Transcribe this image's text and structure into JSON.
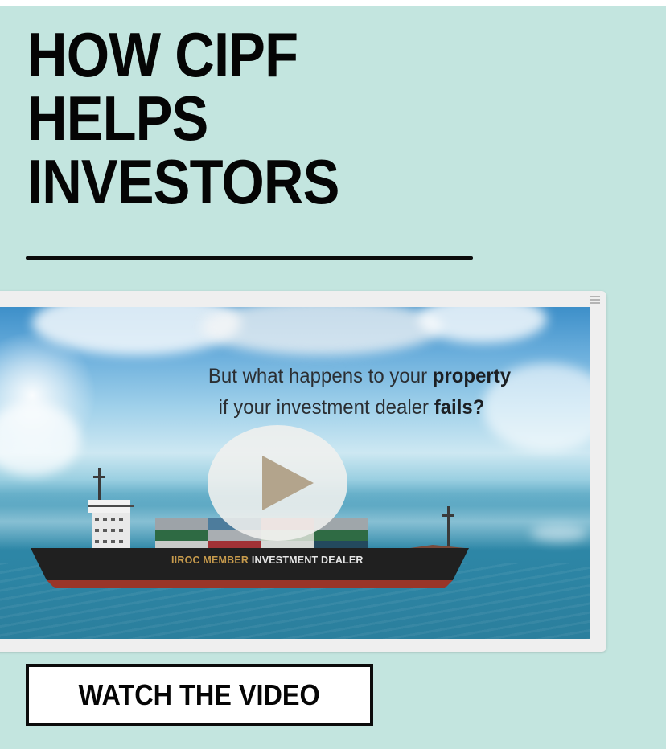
{
  "headline": {
    "line1": "HOW CIPF",
    "line2": "HELPS",
    "line3": "INVESTORS"
  },
  "video": {
    "caption_line1_start": "But what happens to your ",
    "caption_line1_bold": "property",
    "caption_line2_start": "if your investment dealer ",
    "caption_line2_bold": "fails?",
    "hull_label_accent": "IIROC MEMBER",
    "hull_label_rest": " INVESTMENT DEALER",
    "play_icon": "play-icon",
    "menu_icon": "menu-icon"
  },
  "cta": {
    "label": "WATCH THE VIDEO"
  },
  "colors": {
    "panel_background": "#c3e5df",
    "text": "#050505",
    "play_triangle": "#b3a48c",
    "hull_accent": "#c69a4c"
  }
}
